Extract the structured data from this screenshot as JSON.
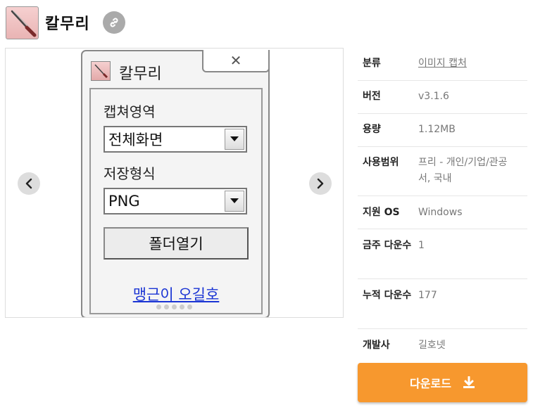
{
  "header": {
    "title": "칼무리",
    "app_icon": "knife-icon",
    "link_icon": "link-icon"
  },
  "screenshot": {
    "window_title": "칼무리",
    "close_glyph": "✕",
    "capture_area_label": "캡쳐영역",
    "capture_area_value": "전체화면",
    "save_format_label": "저장형식",
    "save_format_value": "PNG",
    "folder_button": "폴더열기",
    "author_link": "맹근이 오길호",
    "slide_count": 5
  },
  "info": {
    "category_label": "분류",
    "category_value": "이미지 캡처",
    "version_label": "버전",
    "version_value": "v3.1.6",
    "size_label": "용량",
    "size_value": "1.12MB",
    "license_label": "사용범위",
    "license_value": "프리 - 개인/기업/관공서, 국내",
    "os_label": "지원 OS",
    "os_value": "Windows",
    "weekly_label": "금주 다운수",
    "weekly_value": "1",
    "total_label": "누적 다운수",
    "total_value": "177",
    "developer_label": "개발사",
    "developer_value": "길호넷"
  },
  "download": {
    "label": "다운로드",
    "icon": "download-icon"
  },
  "colors": {
    "accent": "#f7982e",
    "link": "#1a34d4"
  }
}
